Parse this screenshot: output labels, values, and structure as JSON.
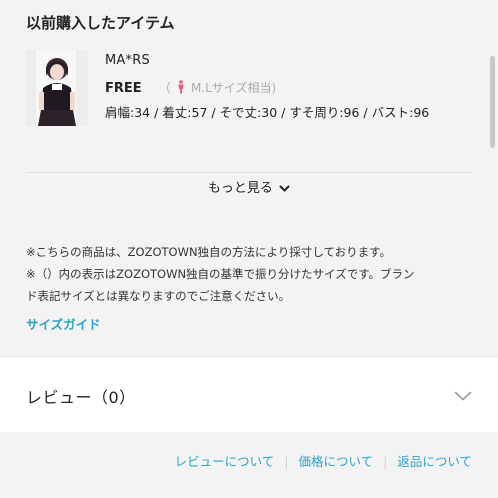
{
  "section": {
    "title": "以前購入したアイテム"
  },
  "item": {
    "brand": "MA*RS",
    "size": "FREE",
    "size_note_open": "（",
    "size_note_text": "M.Lサイズ相当)",
    "measurements": "肩幅:34 / 着丈:57 / そで丈:30 / すそ周り:96 / バスト:96"
  },
  "more": {
    "label": "もっと見る"
  },
  "notes": {
    "line1": "※こちらの商品は、ZOZOTOWN独自の方法により採寸しております。",
    "line2": "※（）内の表示はZOZOTOWN独自の基準で振り分けたサイズです。ブラン",
    "line3": "ド表記サイズとは異なりますのでご注意ください。"
  },
  "size_guide": {
    "label": "サイズガイド"
  },
  "review": {
    "title": "レビュー（0）"
  },
  "footer": {
    "links": [
      "レビューについて",
      "価格について",
      "返品について"
    ],
    "separator": "|"
  },
  "colors": {
    "accent": "#2ba4c9",
    "background": "#f3f3f3",
    "card": "#ffffff",
    "person_icon": "#e0637a"
  },
  "icons": {
    "person": "person-icon",
    "more_chevron": "chevron-down-icon",
    "review_chevron": "chevron-down-icon"
  }
}
